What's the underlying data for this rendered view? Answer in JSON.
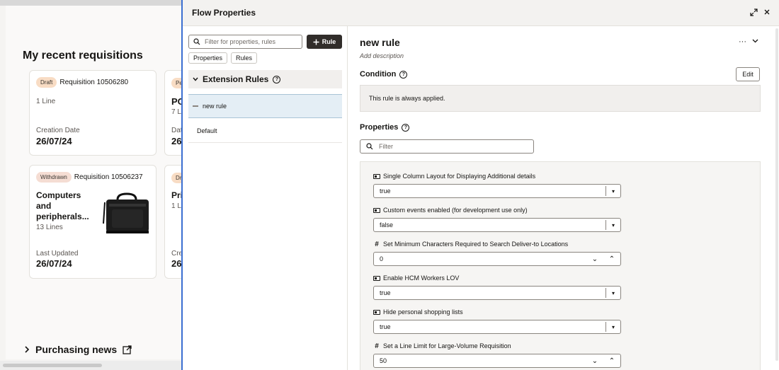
{
  "background": {
    "section_title": "My recent requisitions",
    "cards": [
      {
        "badge": "Draft",
        "requisition": "Requisition 10506280",
        "lines": "1 Line",
        "date_label": "Creation Date",
        "date": "26/07/24"
      },
      {
        "badge": "Pe",
        "title_partial": "PO",
        "lines": "7 L",
        "date_label": "Dat",
        "date": "26"
      },
      {
        "badge": "Withdrawn",
        "requisition": "Requisition 10506237",
        "name": "Computers and peripherals...",
        "lines": "13 Lines",
        "date_label": "Last Updated",
        "date": "26/07/24"
      },
      {
        "badge": "Dr",
        "title_partial": "Pri",
        "lines": "1 L",
        "date_label": "Cre",
        "date": "26"
      }
    ],
    "news_title": "Purchasing news"
  },
  "panel": {
    "title": "Flow Properties",
    "left": {
      "search_placeholder": "Filter for properties, rules",
      "rule_button": "Rule",
      "chips": [
        "Properties",
        "Rules"
      ],
      "section_title": "Extension Rules",
      "rules": [
        "new rule",
        "Default"
      ]
    },
    "right": {
      "rule_title": "new rule",
      "add_description": "Add description",
      "condition_label": "Condition",
      "edit_label": "Edit",
      "condition_text": "This rule is always applied.",
      "properties_label": "Properties",
      "filter_placeholder": "Filter",
      "properties": [
        {
          "type": "boolean",
          "label": "Single Column Layout for Displaying Additional details",
          "value": "true"
        },
        {
          "type": "boolean",
          "label": "Custom events enabled (for development use only)",
          "value": "false"
        },
        {
          "type": "number",
          "label": "Set Minimum Characters Required to Search Deliver-to Locations",
          "value": "0"
        },
        {
          "type": "boolean",
          "label": "Enable HCM Workers LOV",
          "value": "true"
        },
        {
          "type": "boolean",
          "label": "Hide personal shopping lists",
          "value": "true"
        },
        {
          "type": "number",
          "label": "Set a Line Limit for Large-Volume Requisition",
          "value": "50"
        }
      ]
    }
  },
  "icons": {
    "expand": "expand-icon",
    "close": "close-icon",
    "more": "more-icon",
    "chevron": "chevron-down-icon",
    "search": "search-icon",
    "plus": "plus-icon",
    "info": "info-icon",
    "external_link": "external-link-icon"
  }
}
